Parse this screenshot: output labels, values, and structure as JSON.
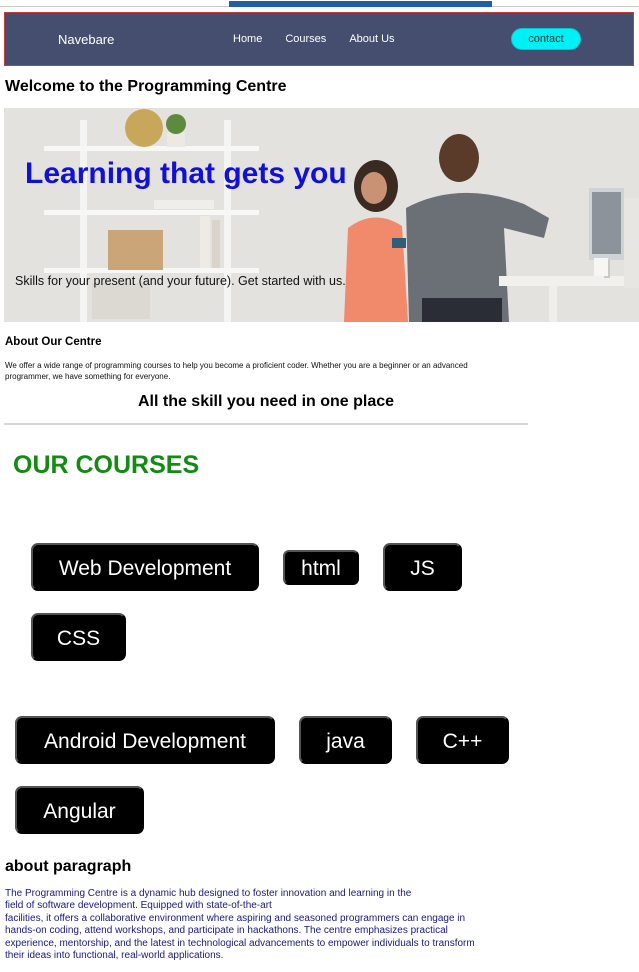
{
  "navbar": {
    "brand": "Navebare",
    "links": [
      "Home",
      "Courses",
      "About Us"
    ],
    "contact_label": "contact"
  },
  "welcome_heading": "Welcome to the Programming Centre",
  "hero": {
    "title": "Learning that gets you",
    "subtitle": "Skills for your present (and your future). Get started with us."
  },
  "about": {
    "heading": "About Our Centre",
    "text": "We offer a wide range of programming courses to help you become a proficient coder. Whether you are a beginner or an advanced programmer, we have something for everyone."
  },
  "skills_heading": "All the skill you need in one place",
  "courses": {
    "heading": "OUR COURSES",
    "items": [
      "Web Development",
      "html",
      "JS",
      "CSS",
      "Android Development",
      "java",
      "C++",
      "Angular"
    ]
  },
  "about_paragraph": {
    "heading": "about paragraph",
    "lines": [
      "The Programming Centre is a dynamic hub designed to foster innovation and learning in the",
      "field of software development. Equipped with state-of-the-art",
      "facilities, it offers a collaborative environment where aspiring and seasoned programmers can engage in",
      "hands-on coding, attend workshops, and participate in hackathons. The centre emphasizes practical",
      "experience, mentorship, and the latest in technological advancements to empower individuals to transform",
      "their ideas into functional, real-world applications."
    ]
  },
  "colors": {
    "navbar_bg": "#454e6e",
    "contact_bg": "#00f0f5",
    "hero_title": "#1010d6",
    "courses_heading": "#138a13",
    "paragraph_text": "#1a1a7a"
  }
}
